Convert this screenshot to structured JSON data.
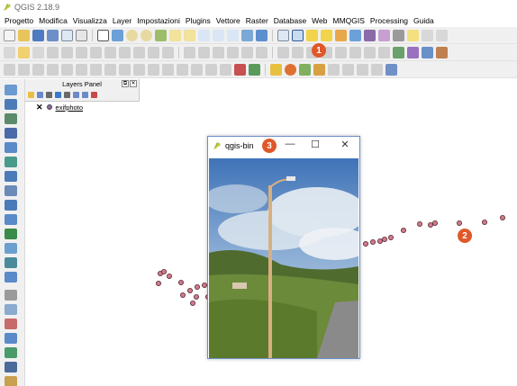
{
  "window": {
    "title": "QGIS 2.18.9"
  },
  "menu": [
    "Progetto",
    "Modifica",
    "Visualizza",
    "Layer",
    "Impostazioni",
    "Plugins",
    "Vettore",
    "Raster",
    "Database",
    "Web",
    "MMQGIS",
    "Processing",
    "Guida"
  ],
  "layers_panel": {
    "title": "Layers Panel",
    "layers": [
      {
        "name": "exifphoto",
        "checked": true
      }
    ]
  },
  "popup": {
    "title": "qgis-bin",
    "min_glyph": "—",
    "max_glyph": "☐",
    "close_glyph": "✕"
  },
  "badges": {
    "one": "1",
    "two": "2",
    "three": "3"
  },
  "colors": {
    "badge": "#e0582a",
    "point_fill": "#d07a8c",
    "point_stroke": "#5a2a35"
  }
}
